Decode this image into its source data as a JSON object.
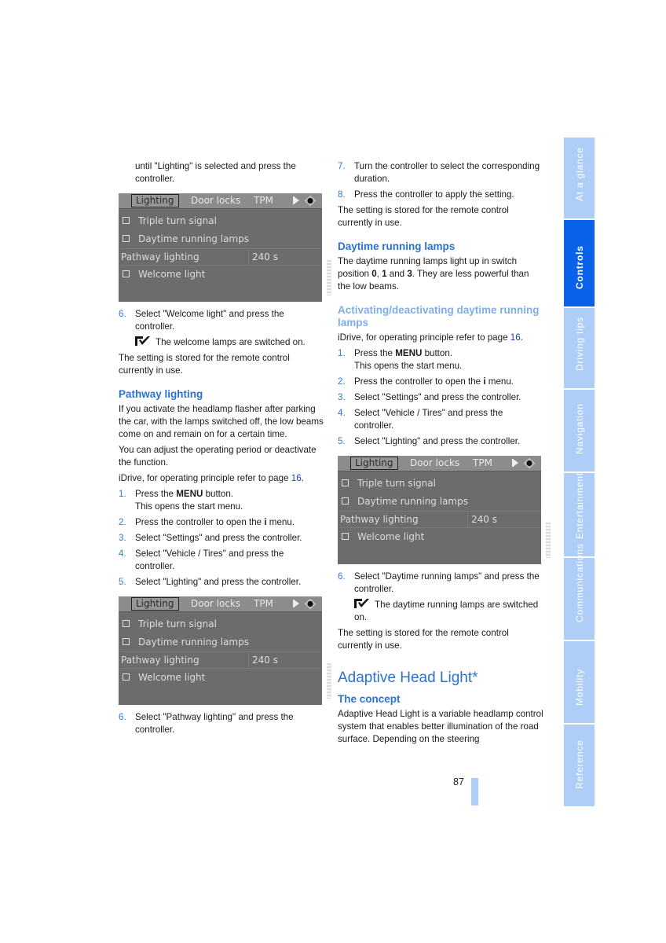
{
  "screen": {
    "tabs": [
      "Lighting",
      "Door locks",
      "TPM"
    ],
    "active_tab": "Lighting",
    "rows": [
      {
        "type": "checkbox",
        "label": "Triple turn signal",
        "checked": false
      },
      {
        "type": "checkbox",
        "label": "Daytime running lamps",
        "checked": false
      },
      {
        "type": "value",
        "label": "Pathway lighting",
        "value": "240 s"
      },
      {
        "type": "checkbox",
        "label": "Welcome light",
        "checked": false
      }
    ]
  },
  "left": {
    "intro": "until \"Lighting\" is selected and press the controller.",
    "step6_welcome": {
      "num": "6.",
      "text": "Select \"Welcome light\" and press the controller."
    },
    "welcome_note": "The welcome lamps are switched on.",
    "stored1": "The setting is stored for the remote control currently in use.",
    "pathway_heading": "Pathway lighting",
    "pathway_p1": "If you activate the headlamp flasher after parking the car, with the lamps switched off, the low beams come on and remain on for a certain time.",
    "pathway_p2": "You can adjust the operating period or deactivate the function.",
    "idrive_prefix": "iDrive, for operating principle refer to page ",
    "idrive_page": "16",
    "idrive_suffix": ".",
    "steps": [
      {
        "num": "1.",
        "pre": "Press the ",
        "bold": "MENU",
        "post": " button.",
        "line2": "This opens the start menu."
      },
      {
        "num": "2.",
        "pre": "Press the controller to open the ",
        "bold": "i",
        "post": " menu.",
        "line2": ""
      },
      {
        "num": "3.",
        "pre": "Select \"Settings\" and press the controller.",
        "bold": "",
        "post": "",
        "line2": ""
      },
      {
        "num": "4.",
        "pre": "Select \"Vehicle / Tires\" and press the controller.",
        "bold": "",
        "post": "",
        "line2": ""
      },
      {
        "num": "5.",
        "pre": "Select \"Lighting\" and press the controller.",
        "bold": "",
        "post": "",
        "line2": ""
      }
    ],
    "step6_pathway": {
      "num": "6.",
      "text": "Select \"Pathway lighting\" and press the controller."
    }
  },
  "right": {
    "step7": {
      "num": "7.",
      "text": "Turn the controller to select the corresponding duration."
    },
    "step8": {
      "num": "8.",
      "text": "Press the controller to apply the setting."
    },
    "stored2": "The setting is stored for the remote control currently in use.",
    "drl_heading": "Daytime running lamps",
    "drl_p_pre": "The daytime running lamps light up in switch position ",
    "drl_p_b1": "0",
    "drl_p_mid1": ", ",
    "drl_p_b2": "1",
    "drl_p_mid2": " and ",
    "drl_p_b3": "3",
    "drl_p_post": ". They are less powerful than the low beams.",
    "act_heading": "Activating/deactivating daytime running lamps",
    "idrive_prefix": "iDrive, for operating principle refer to page ",
    "idrive_page": "16",
    "idrive_suffix": ".",
    "steps": [
      {
        "num": "1.",
        "pre": "Press the ",
        "bold": "MENU",
        "post": " button.",
        "line2": "This opens the start menu."
      },
      {
        "num": "2.",
        "pre": "Press the controller to open the ",
        "bold": "i",
        "post": " menu.",
        "line2": ""
      },
      {
        "num": "3.",
        "pre": "Select \"Settings\" and press the controller.",
        "bold": "",
        "post": "",
        "line2": ""
      },
      {
        "num": "4.",
        "pre": "Select \"Vehicle / Tires\" and press the controller.",
        "bold": "",
        "post": "",
        "line2": ""
      },
      {
        "num": "5.",
        "pre": "Select \"Lighting\" and press the controller.",
        "bold": "",
        "post": "",
        "line2": ""
      }
    ],
    "step6_drl": {
      "num": "6.",
      "text": "Select \"Daytime running lamps\" and press the controller."
    },
    "drl_note": "The daytime running lamps are switched on.",
    "stored3": "The setting is stored for the remote control currently in use.",
    "ahl_heading": "Adaptive Head Light*",
    "concept_heading": "The concept",
    "concept_p": "Adaptive Head Light is a variable headlamp control system that enables better illumination of the road surface. Depending on the steering"
  },
  "sidebar": {
    "tabs": [
      {
        "label": "At a glance",
        "active": false
      },
      {
        "label": "Controls",
        "active": true
      },
      {
        "label": "Driving tips",
        "active": false
      },
      {
        "label": "Navigation",
        "active": false
      },
      {
        "label": "Entertainment",
        "active": false
      },
      {
        "label": "Communications",
        "active": false
      },
      {
        "label": "Mobility",
        "active": false
      },
      {
        "label": "Reference",
        "active": false
      }
    ]
  },
  "page_number": "87",
  "colors": {
    "accent": "#2a72d4",
    "sidebar_active": "#0a62e8",
    "sidebar_inactive": "#aecdf7",
    "screen_bg": "#6c6c6c"
  }
}
